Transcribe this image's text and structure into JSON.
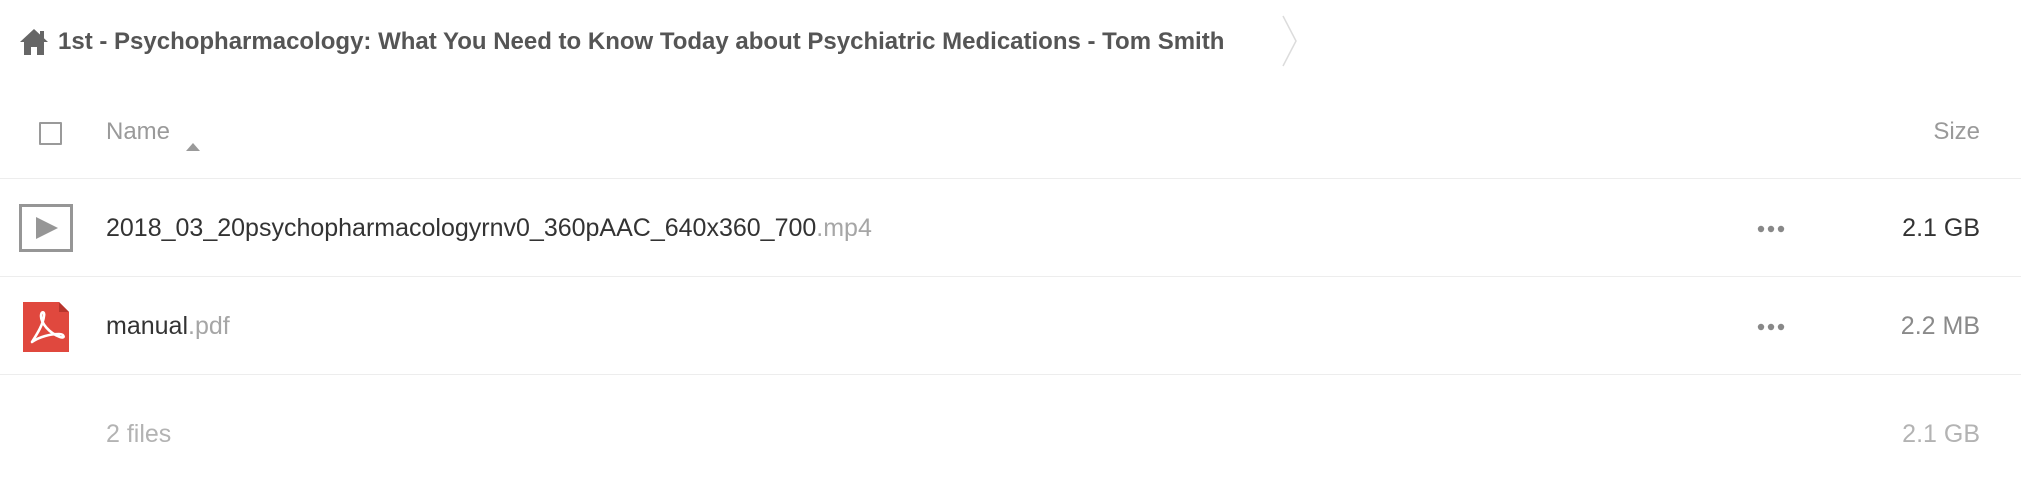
{
  "breadcrumb": {
    "home_icon": "home-icon",
    "title": "1st - Psychopharmacology: What You Need to Know Today about Psychiatric Medications - Tom Smith",
    "separator_icon": "chevron-right-icon"
  },
  "header": {
    "name_label": "Name",
    "size_label": "Size",
    "sort_icon": "sort-ascending-icon"
  },
  "files": [
    {
      "icon": "video-icon",
      "basename": "2018_03_20psychopharmacologyrnv0_360pAAC_640x360_700",
      "extension": ".mp4",
      "size": "2.1 GB",
      "actions_icon": "more-icon"
    },
    {
      "icon": "pdf-icon",
      "basename": "manual",
      "extension": ".pdf",
      "size": "2.2 MB",
      "actions_icon": "more-icon"
    }
  ],
  "summary": {
    "files_count": "2 files",
    "total_size": "2.1 GB"
  },
  "colors": {
    "pdf_red": "#e0483e",
    "icon_gray": "#969696",
    "home_gray": "#666666"
  }
}
